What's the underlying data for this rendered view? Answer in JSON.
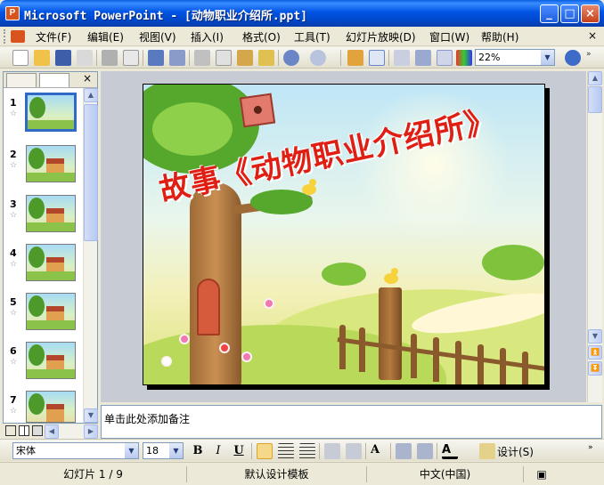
{
  "window": {
    "title": "Microsoft PowerPoint - [动物职业介绍所.ppt]"
  },
  "menu": [
    "文件(F)",
    "编辑(E)",
    "视图(V)",
    "插入(I)",
    "格式(O)",
    "工具(T)",
    "幻灯片放映(D)",
    "窗口(W)",
    "帮助(H)"
  ],
  "toolbar": {
    "zoom": "22%"
  },
  "thumbnails": [
    {
      "num": "1"
    },
    {
      "num": "2"
    },
    {
      "num": "3"
    },
    {
      "num": "4"
    },
    {
      "num": "5"
    },
    {
      "num": "6"
    },
    {
      "num": "7"
    }
  ],
  "slide": {
    "title": "故事《动物职业介绍所》"
  },
  "notes": {
    "placeholder": "单击此处添加备注"
  },
  "format": {
    "font": "宋体",
    "size": "18",
    "bold": "B",
    "italic": "I",
    "underline": "U",
    "design_label": "设计(S)"
  },
  "status": {
    "slide_counter": "幻灯片 1 / 9",
    "template": "默认设计模板",
    "language": "中文(中国)"
  },
  "colors": {
    "titlebar": "#0054e3",
    "slide_title": "#e01f14",
    "selection": "#316ac5"
  }
}
